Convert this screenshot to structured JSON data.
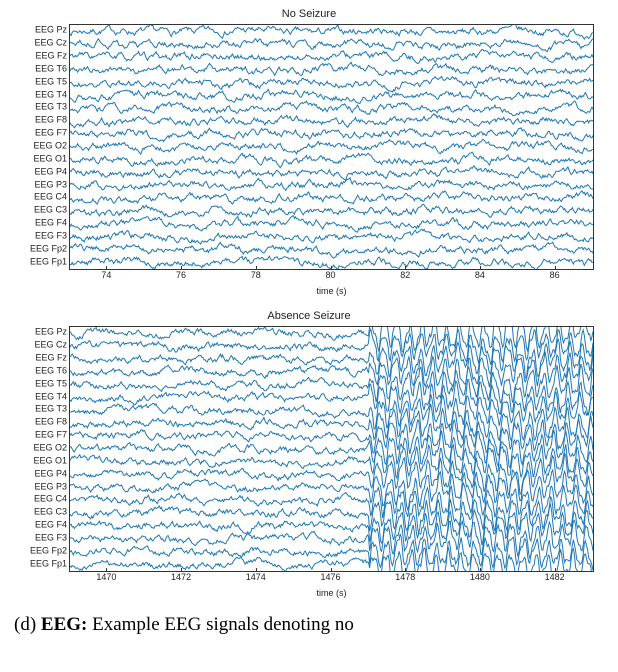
{
  "chart_data": [
    {
      "type": "line",
      "title": "No Seizure",
      "xlabel": "time (s)",
      "ylabel": "",
      "xlim": [
        73,
        87
      ],
      "x_ticks": [
        74,
        76,
        78,
        80,
        82,
        84,
        86
      ],
      "channels": [
        "EEG Pz",
        "EEG Cz",
        "EEG Fz",
        "EEG T6",
        "EEG T5",
        "EEG T4",
        "EEG T3",
        "EEG F8",
        "EEG F7",
        "EEG O2",
        "EEG O1",
        "EEG P4",
        "EEG P3",
        "EEG C4",
        "EEG C3",
        "EEG F4",
        "EEG F3",
        "EEG Fp2",
        "EEG Fp1"
      ],
      "note": "multichannel baseline EEG; all channels show low-amplitude irregular activity, no ictal pattern",
      "seizure_onset_s": null
    },
    {
      "type": "line",
      "title": "Absence Seizure",
      "xlabel": "time (s)",
      "ylabel": "",
      "xlim": [
        1469,
        1483
      ],
      "x_ticks": [
        1470,
        1472,
        1474,
        1476,
        1478,
        1480,
        1482
      ],
      "channels": [
        "EEG Pz",
        "EEG Cz",
        "EEG Fz",
        "EEG T6",
        "EEG T5",
        "EEG T4",
        "EEG T3",
        "EEG F8",
        "EEG F7",
        "EEG O2",
        "EEG O1",
        "EEG P4",
        "EEG P3",
        "EEG C4",
        "EEG C3",
        "EEG F4",
        "EEG F3",
        "EEG Fp2",
        "EEG Fp1"
      ],
      "note": "generalized ~3 Hz spike-and-wave onset near 1477 s across all channels, large amplitude through end of window",
      "seizure_onset_s": 1477
    }
  ],
  "caption_prefix": "(d)",
  "caption_bold": "EEG:",
  "caption_rest": "Example EEG signals denoting no",
  "trace_color": "#1f77b4"
}
